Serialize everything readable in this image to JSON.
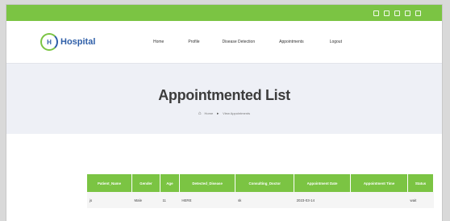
{
  "social_icons": [
    "social-icon-1",
    "social-icon-2",
    "social-icon-3",
    "social-icon-4",
    "social-icon-5"
  ],
  "header": {
    "logo_mark": "H",
    "logo_text": "Hospital",
    "nav": {
      "home": "Home",
      "profile": "Profile",
      "disease_detection": "Disease Detection",
      "appointments": "Appointments",
      "logout": "Logout"
    }
  },
  "hero": {
    "title": "Appointmented List",
    "breadcrumb_home": "Home",
    "breadcrumb_current": "View Appointments"
  },
  "table": {
    "columns": [
      "Patient_Name",
      "Gender",
      "Age",
      "Detected_Disease",
      "Consulting_Doctor",
      "Appointment Date",
      "Appointment Time",
      "Status"
    ],
    "rows": [
      [
        "js",
        "Male",
        "11",
        "HERE",
        "sk",
        "2023-03-14",
        "",
        "wait"
      ]
    ]
  },
  "colors": {
    "accent_green": "#7bc443",
    "brand_blue": "#2e5ea8",
    "hero_bg": "#eef0f6"
  }
}
